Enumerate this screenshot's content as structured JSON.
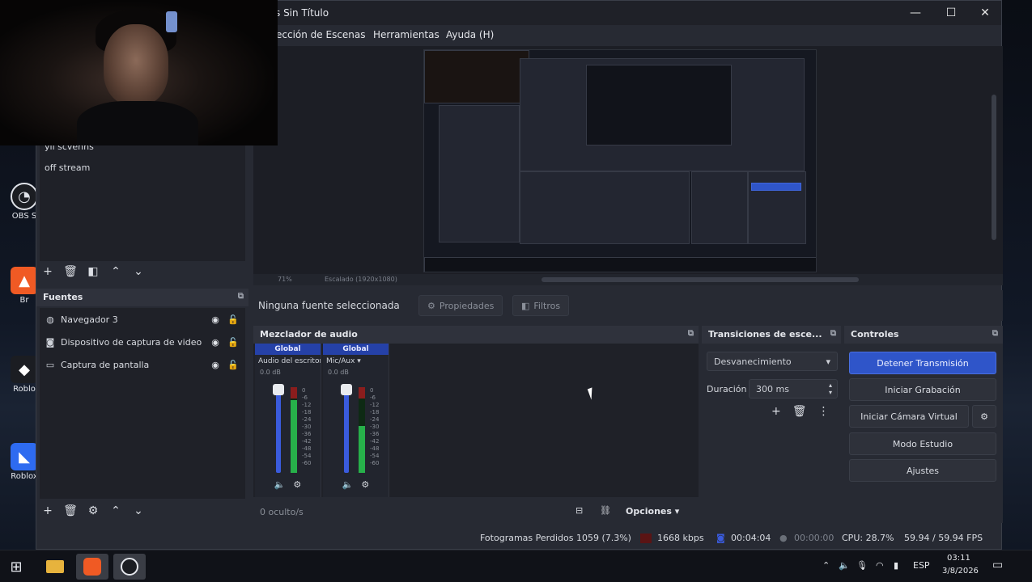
{
  "window": {
    "title": "s Sin Título",
    "minimize": "—",
    "maximize": "☐",
    "close": "✕"
  },
  "menu": {
    "scene_collection": "ección de Escenas",
    "tools": "Herramientas",
    "help": "Ayuda (H)"
  },
  "scenes": {
    "items": [
      "yii scvenns",
      "off stream"
    ]
  },
  "preview_bar": {
    "zoom": "71%",
    "info": "Escalado (1920x1080)"
  },
  "sources": {
    "title": "Fuentes",
    "items": [
      {
        "label": "Navegador 3",
        "icon": "globe-icon"
      },
      {
        "label": "Dispositivo de captura de video",
        "icon": "camera-icon"
      },
      {
        "label": "Captura de pantalla",
        "icon": "monitor-icon"
      }
    ]
  },
  "context": {
    "no_source": "Ninguna fuente seleccionada",
    "properties": "Propiedades",
    "filters": "Filtros"
  },
  "mixer": {
    "title": "Mezclador de audio",
    "channels": [
      {
        "group": "Global",
        "name": "Audio del escritorio",
        "db": "0.0 dB",
        "level": 0.85
      },
      {
        "group": "Global",
        "name": "Mic/Aux",
        "db": "0.0 dB",
        "level": 0.55
      }
    ],
    "scale": [
      "0",
      "-6",
      "-12",
      "-18",
      "-24",
      "-30",
      "-36",
      "-42",
      "-48",
      "-54",
      "-60"
    ],
    "hidden": "0 oculto/s",
    "options": "Opciones"
  },
  "transitions": {
    "title": "Transiciones de esce...",
    "type": "Desvanecimiento",
    "duration_label": "Duración",
    "duration_value": "300 ms"
  },
  "controls": {
    "title": "Controles",
    "stop_stream": "Detener Transmisión",
    "start_recording": "Iniciar Grabación",
    "start_virtualcam": "Iniciar Cámara Virtual",
    "studio_mode": "Modo Estudio",
    "settings": "Ajustes"
  },
  "status": {
    "dropped": "Fotogramas Perdidos 1059 (7.3%)",
    "bitrate": "1668 kbps",
    "stream_time": "00:04:04",
    "rec_time": "00:00:00",
    "cpu": "CPU: 28.7%",
    "fps": "59.94 / 59.94 FPS"
  },
  "desktop": {
    "icons": [
      {
        "label": "OBS S",
        "icon": "obs-icon"
      },
      {
        "label": "Br",
        "icon": "brave-icon"
      },
      {
        "label": "Roblo",
        "icon": "roblox-icon"
      },
      {
        "label": "Roblox",
        "icon": "roblox-studio-icon"
      }
    ]
  },
  "taskbar": {
    "lang": "ESP",
    "time": "03:11",
    "date": "3/8/2026"
  },
  "colors": {
    "accent": "#2f55c9",
    "panel": "#272a33",
    "panel_dark": "#1f2128"
  }
}
